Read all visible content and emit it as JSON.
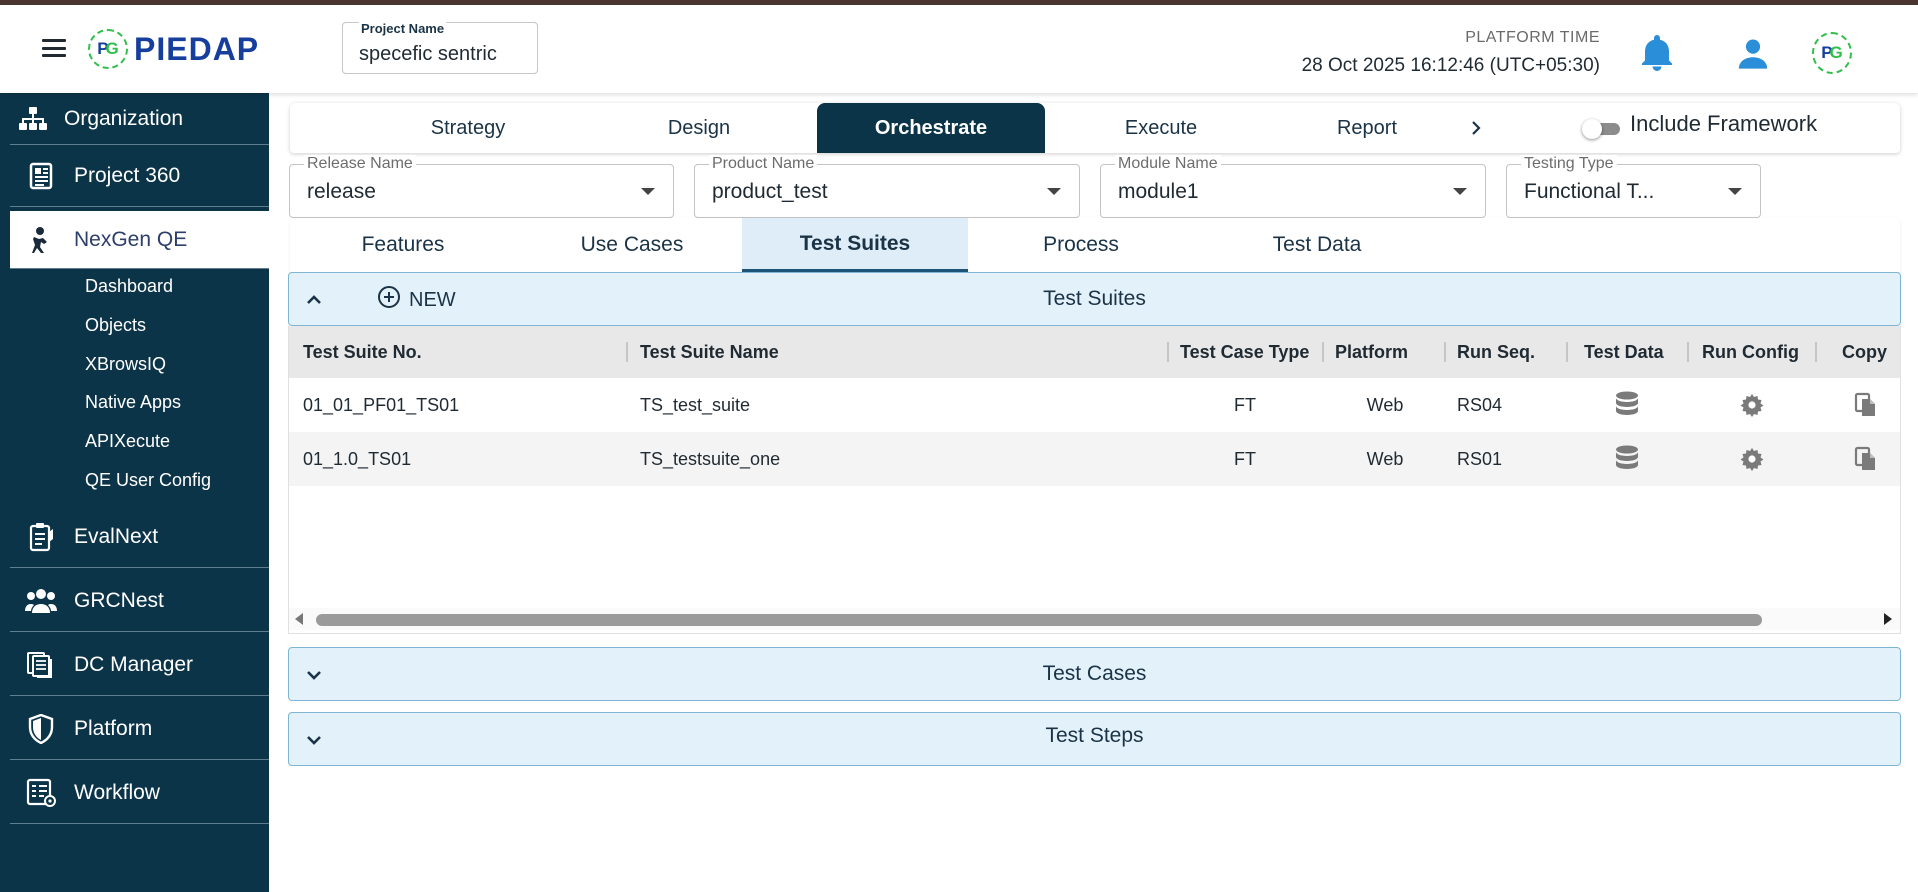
{
  "header": {
    "logo_text": "PIEDAP",
    "logo_badge_p": "P",
    "logo_badge_g": "G",
    "project_name_label": "Project Name",
    "project_name_value": "specefic sentric",
    "platform_time_label": "PLATFORM TIME",
    "platform_time_value": "28 Oct 2025 16:12:46 (UTC+05:30)",
    "icons": [
      "menu-icon",
      "bell-icon",
      "user-icon",
      "brand-badge-icon"
    ]
  },
  "sidebar": {
    "items": [
      {
        "label": "Organization",
        "icon": "hierarchy-icon"
      },
      {
        "label": "Project 360",
        "icon": "newspaper-icon"
      },
      {
        "label": "NexGen QE",
        "icon": "agent-icon"
      },
      {
        "label": "EvalNext",
        "icon": "clipboard-icon"
      },
      {
        "label": "GRCNest",
        "icon": "users-icon"
      },
      {
        "label": "DC Manager",
        "icon": "documents-icon"
      },
      {
        "label": "Platform",
        "icon": "shield-icon"
      },
      {
        "label": "Workflow",
        "icon": "workflow-icon"
      }
    ],
    "sub_items": [
      "Dashboard",
      "Objects",
      "XBrowsIQ",
      "Native Apps",
      "APIXecute",
      "QE User Config"
    ],
    "active": "NexGen QE"
  },
  "tabs": {
    "items": [
      "Strategy",
      "Design",
      "Orchestrate",
      "Execute",
      "Report"
    ],
    "active": "Orchestrate",
    "include_framework_label": "Include Framework",
    "include_framework_on": false
  },
  "filters": {
    "release": {
      "label": "Release Name",
      "value": "release"
    },
    "product": {
      "label": "Product Name",
      "value": "product_test"
    },
    "module": {
      "label": "Module Name",
      "value": "module1"
    },
    "testing_type": {
      "label": "Testing Type",
      "value": "Functional T..."
    }
  },
  "subtabs": {
    "items": [
      "Features",
      "Use Cases",
      "Test Suites",
      "Process",
      "Test Data"
    ],
    "active": "Test Suites"
  },
  "test_suites": {
    "title": "Test Suites",
    "new_label": "NEW",
    "columns": [
      "Test Suite No.",
      "Test Suite Name",
      "Test Case Type",
      "Platform",
      "Run Seq.",
      "Test Data",
      "Run Config",
      "Copy"
    ],
    "rows": [
      {
        "no": "01_01_PF01_TS01",
        "name": "TS_test_suite",
        "type": "FT",
        "platform": "Web",
        "run_seq": "RS04"
      },
      {
        "no": "01_1.0_TS01",
        "name": "TS_testsuite_one",
        "type": "FT",
        "platform": "Web",
        "run_seq": "RS01"
      }
    ]
  },
  "test_cases": {
    "title": "Test Cases"
  },
  "test_steps": {
    "title": "Test Steps"
  },
  "colors": {
    "sidebar_bg": "#0c3448",
    "brand_blue": "#163e9c",
    "brand_green": "#2fbf4a",
    "panel_bg": "#e3f1fb"
  }
}
